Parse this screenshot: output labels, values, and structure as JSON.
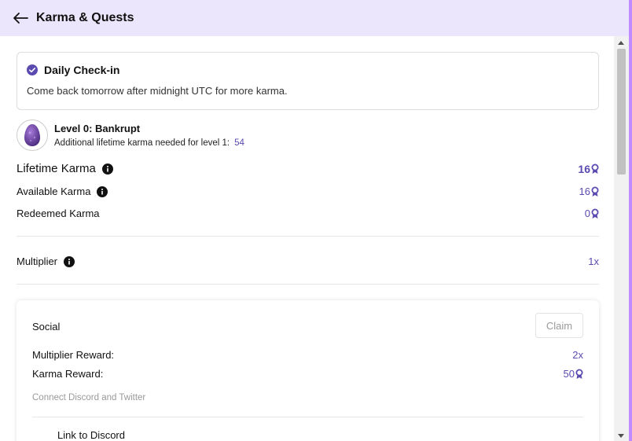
{
  "header": {
    "title": "Karma & Quests",
    "back_icon": "arrow-left-icon"
  },
  "checkin": {
    "title": "Daily Check-in",
    "message": "Come back tomorrow after midnight UTC for more karma.",
    "icon": "check-circle-icon"
  },
  "level": {
    "title": "Level 0: Bankrupt",
    "subtitle": "Additional lifetime karma needed for level 1:",
    "needed": "54",
    "icon": "egg-icon"
  },
  "stats": {
    "lifetime": {
      "label": "Lifetime Karma",
      "value": "16"
    },
    "available": {
      "label": "Available Karma",
      "value": "16"
    },
    "redeemed": {
      "label": "Redeemed Karma",
      "value": "0"
    },
    "multiplier": {
      "label": "Multiplier",
      "value": "1x"
    }
  },
  "quest": {
    "name": "Social",
    "claim_label": "Claim",
    "multiplier_reward_label": "Multiplier Reward:",
    "multiplier_reward_value": "2x",
    "karma_reward_label": "Karma Reward:",
    "karma_reward_value": "50",
    "description": "Connect Discord and Twitter",
    "sub_item": "Link to Discord"
  },
  "colors": {
    "accent": "#5b4ab0",
    "header_bg": "#ebe6fb"
  }
}
